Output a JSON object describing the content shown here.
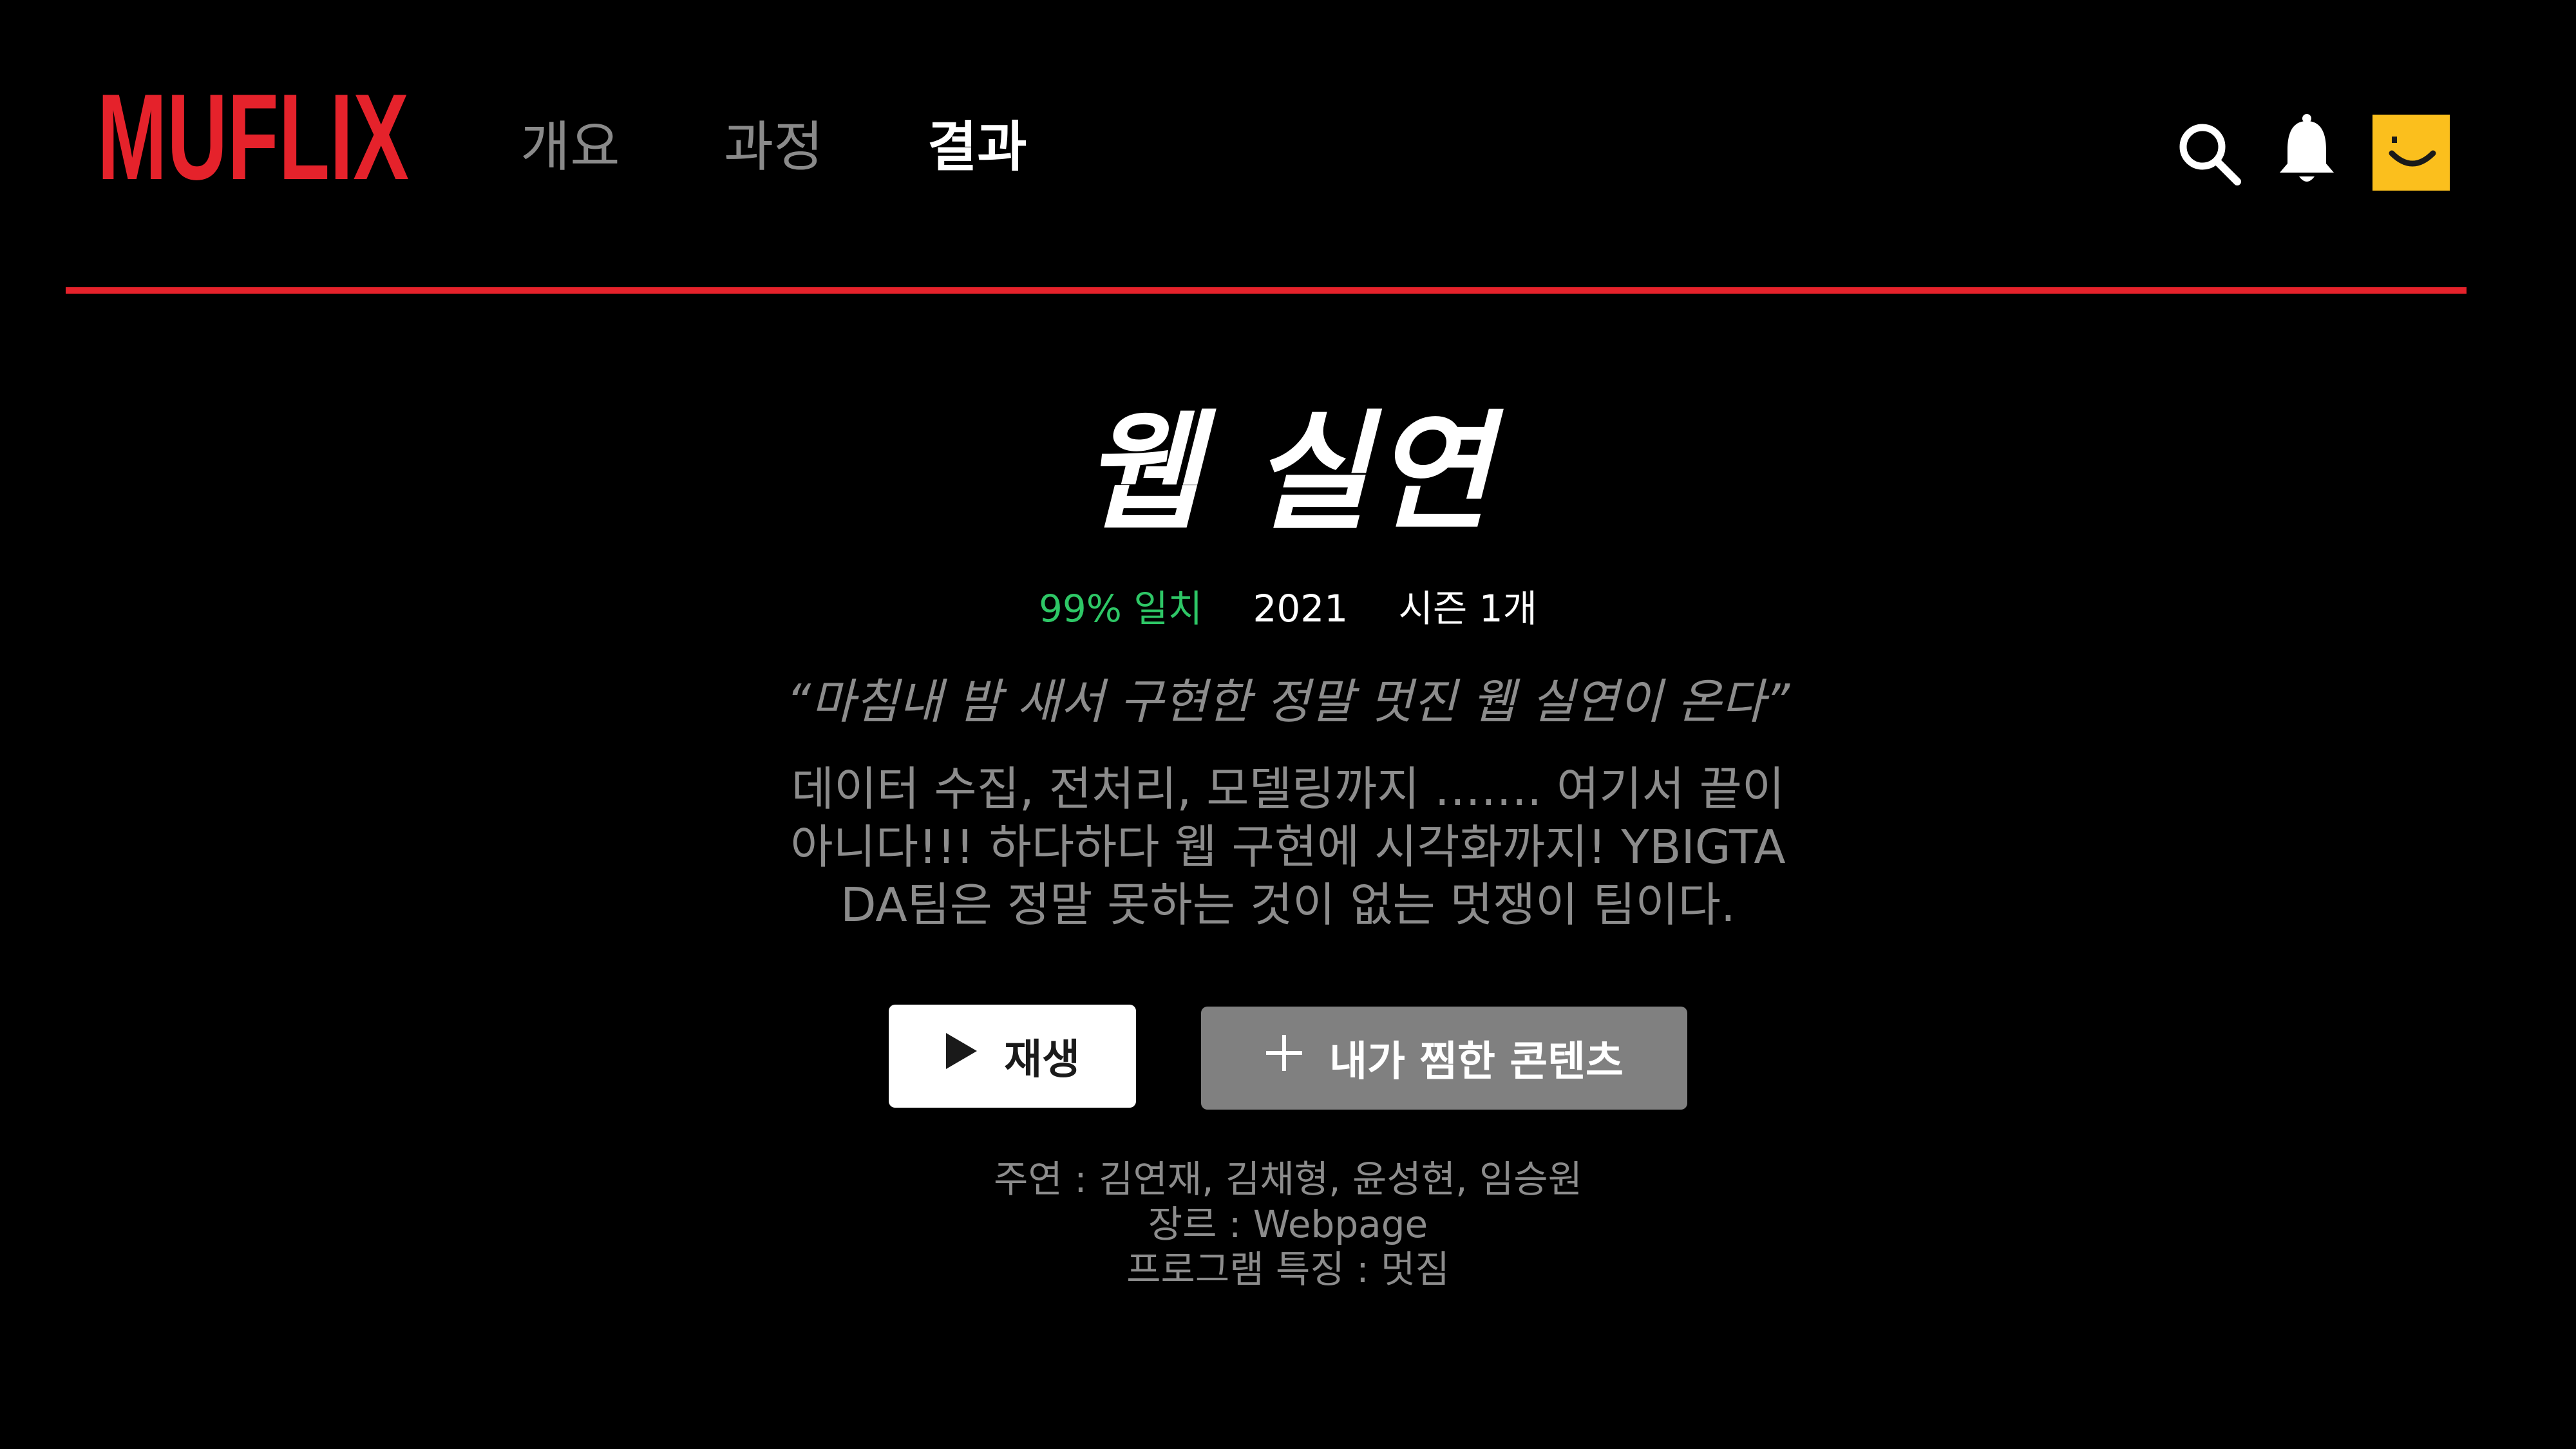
{
  "header": {
    "logo_text": "MUFLIX",
    "nav": [
      {
        "label": "개요",
        "active": false
      },
      {
        "label": "과정",
        "active": false
      },
      {
        "label": "결과",
        "active": true
      }
    ],
    "icons": [
      "search-icon",
      "bell-icon",
      "avatar-icon"
    ]
  },
  "hero": {
    "title": "웹 실연",
    "match": "99% 일치",
    "year": "2021",
    "season": "시즌 1개",
    "tagline": "“마침내 밤 새서 구현한 정말 멋진 웹 실연이 온다”",
    "description": "데이터 수집, 전처리, 모델링까지 ……. 여기서 끝이 아니다!!! 하다하다 웹 구현에 시각화까지! YBIGTA DA팀은 정말 못하는 것이 없는 멋쟁이 팀이다."
  },
  "buttons": {
    "play_label": "재생",
    "mylist_label": "내가 찜한 콘텐츠"
  },
  "credits": {
    "cast": "주연 : 김연재, 김채형, 윤성현, 임승원",
    "genre": "장르 : Webpage",
    "feature": "프로그램 특징 : 멋짐"
  },
  "colors": {
    "brand_red": "#e5222b",
    "match_green": "#2ec766",
    "avatar_yellow": "#fbbf1d",
    "muted_text": "#8c8c8c"
  }
}
